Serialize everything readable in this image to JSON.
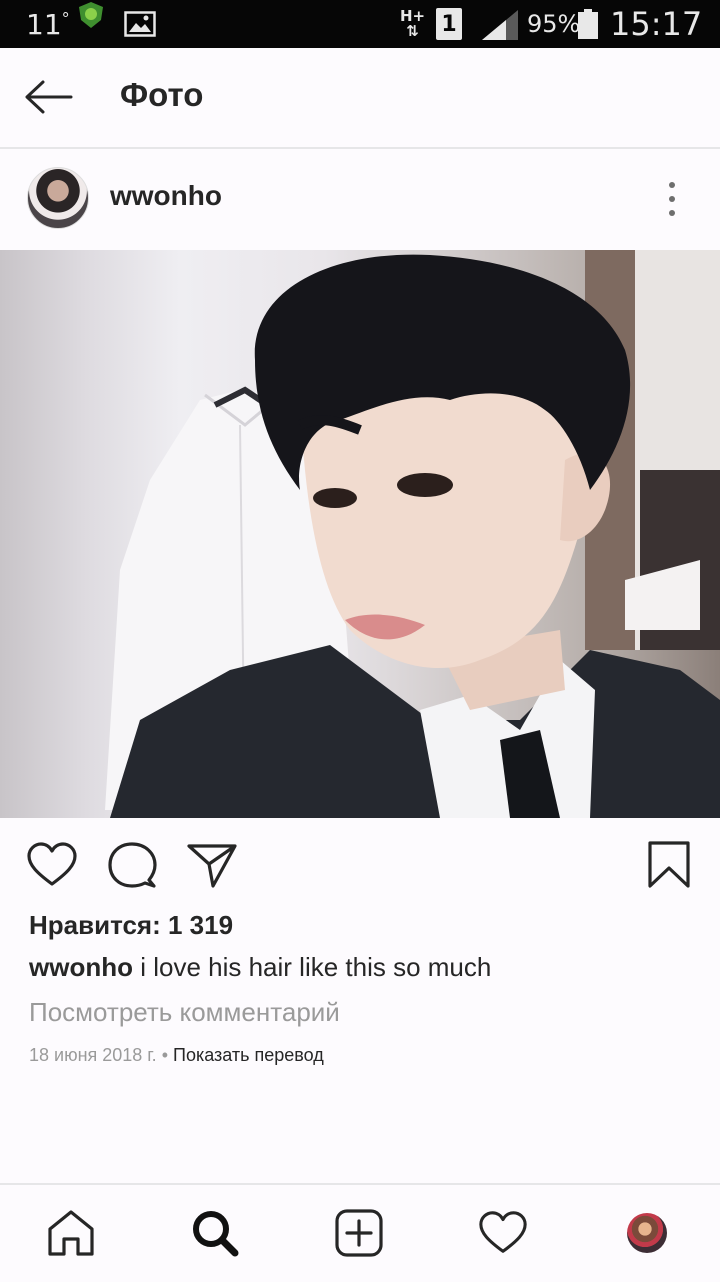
{
  "status_bar": {
    "temperature": "11",
    "temperature_unit": "°",
    "network_top": "H+",
    "network_bottom": "⇅",
    "sim_number": "1",
    "battery_percent": "95%",
    "time": "15:17",
    "icons": [
      "weather-shield-icon",
      "image-icon",
      "signal-icon",
      "battery-icon"
    ]
  },
  "header": {
    "title": "Фото",
    "back_icon": "arrow-left-icon"
  },
  "post": {
    "username": "wwonho",
    "likes": "Нравится: 1 319",
    "caption_user": "wwonho",
    "caption_text": " i love his hair like this so much",
    "view_comments": "Посмотреть комментарий",
    "date": "18 июня 2018 г.",
    "separator": " • ",
    "show_translation": "Показать перевод",
    "action_icons": [
      "heart-icon",
      "comment-icon",
      "share-icon",
      "bookmark-icon"
    ]
  },
  "bottom_nav": {
    "items": [
      "home-icon",
      "search-icon",
      "add-post-icon",
      "activity-heart-icon",
      "profile-avatar"
    ]
  },
  "colors": {
    "text": "#262626",
    "muted": "#9a9a9a",
    "background": "#fdfbfe",
    "status_bar": "#060606"
  }
}
